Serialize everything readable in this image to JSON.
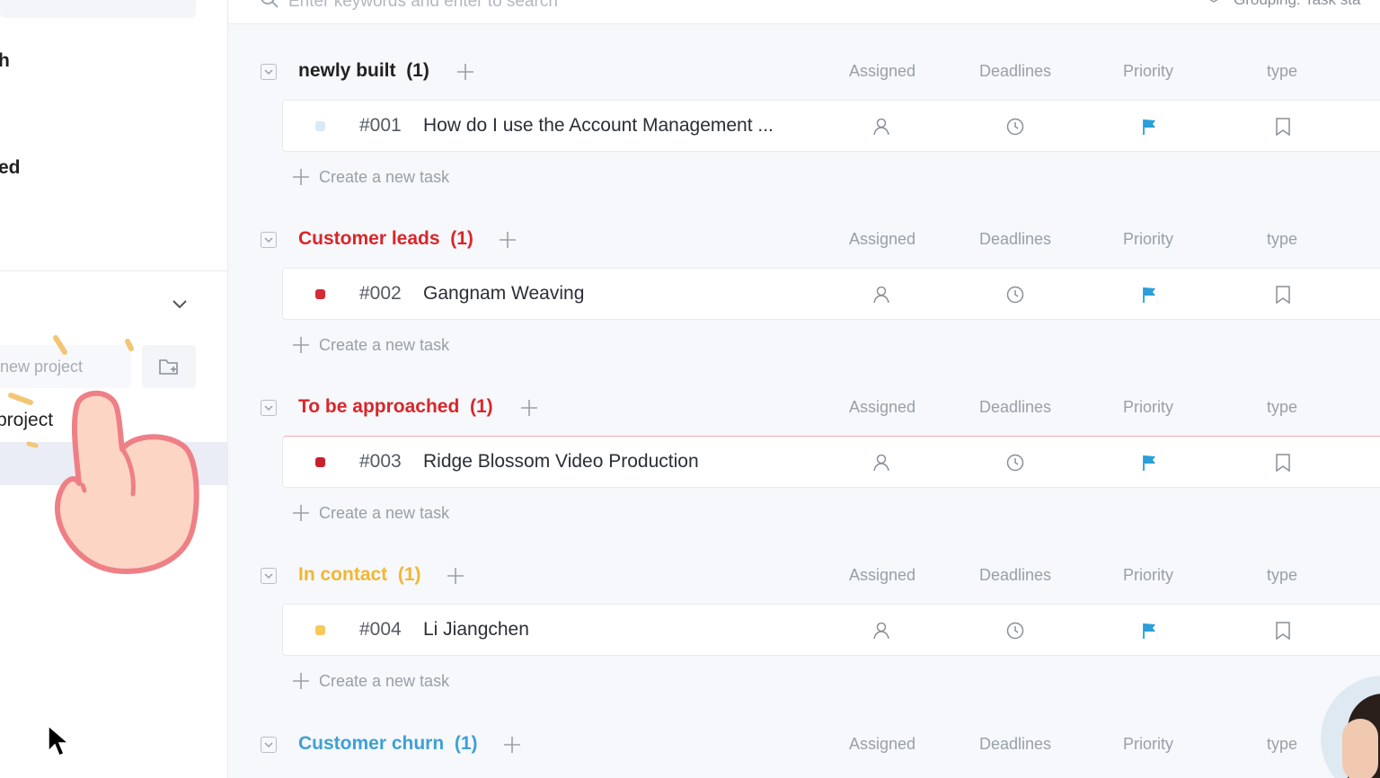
{
  "sidebar": {
    "items": [
      {
        "label": "h"
      },
      {
        "label": "ed"
      }
    ],
    "new_project_placeholder": "new project",
    "project_label": "project"
  },
  "search": {
    "placeholder": "Enter keywords and enter to search"
  },
  "grouping": {
    "label": "Grouping: Task sta"
  },
  "columns": {
    "assigned": "Assigned",
    "deadlines": "Deadlines",
    "priority": "Priority",
    "type": "type"
  },
  "create_task_label": "Create a new task",
  "groups": [
    {
      "title": "newly built",
      "count": "(1)",
      "color": "#222222",
      "task": {
        "id": "#001",
        "title": "How do I use the Account Management ...",
        "status_color": "#d6ebf7"
      }
    },
    {
      "title": "Customer leads",
      "count": "(1)",
      "color": "#d9262a",
      "task": {
        "id": "#002",
        "title": "Gangnam Weaving",
        "status_color": "#d52b35"
      }
    },
    {
      "title": "To be approached",
      "count": "(1)",
      "color": "#d9262a",
      "task": {
        "id": "#003",
        "title": "Ridge Blossom Video Production",
        "status_color": "#c8202c"
      }
    },
    {
      "title": "In contact",
      "count": "(1)",
      "color": "#f2b632",
      "task": {
        "id": "#004",
        "title": "Li Jiangchen",
        "status_color": "#f7c85a"
      }
    },
    {
      "title": "Customer churn",
      "count": "(1)",
      "color": "#3ea0d6",
      "task": null
    }
  ],
  "icons": {
    "assigned": "user-icon",
    "deadline": "clock-icon",
    "priority": "flag-icon",
    "type": "bookmark-icon"
  },
  "colors": {
    "flag": "#2a9fd8",
    "icon_gray": "#9aa0a8"
  }
}
